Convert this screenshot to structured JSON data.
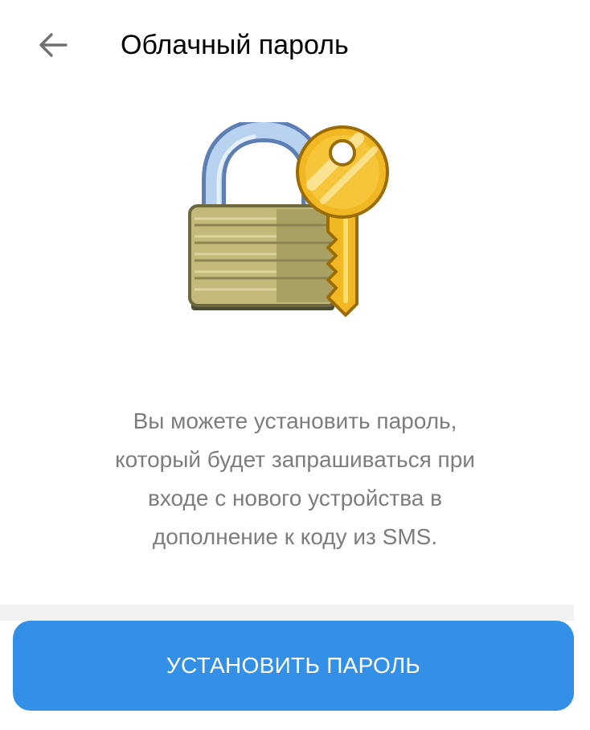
{
  "header": {
    "title": "Облачный пароль",
    "back_icon": "arrow-left-icon"
  },
  "illustration": {
    "icon": "lock-with-key-icon"
  },
  "description": {
    "lines": [
      "Вы можете установить пароль,",
      "который будет запрашиваться при",
      "входе с нового устройства в",
      "дополнение к коду из SMS."
    ]
  },
  "actions": {
    "set_password_label": "УСТАНОВИТЬ ПАРОЛЬ"
  },
  "colors": {
    "accent": "#3390e6",
    "text_secondary": "#7d7d7d",
    "divider": "#f2f2f2"
  }
}
